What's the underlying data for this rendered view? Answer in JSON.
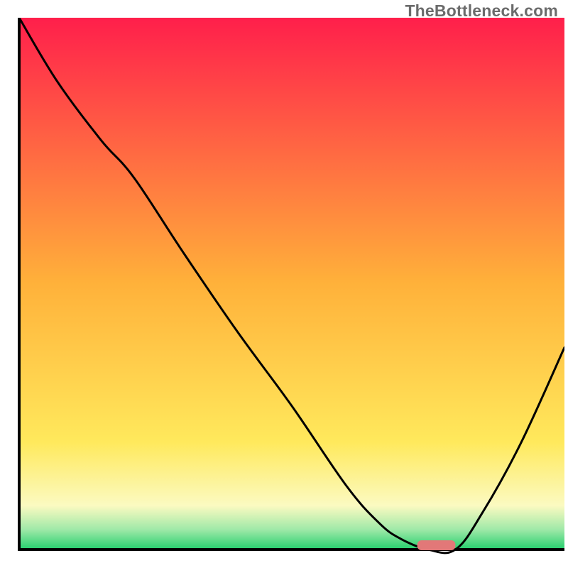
{
  "attribution": "TheBottleneck.com",
  "chart_data": {
    "type": "line",
    "title": "",
    "xlabel": "",
    "ylabel": "",
    "xlim": [
      0,
      100
    ],
    "ylim": [
      0,
      100
    ],
    "gradient_stops": [
      {
        "offset": 0.0,
        "color": "#ff1f4b"
      },
      {
        "offset": 0.5,
        "color": "#ffb13a"
      },
      {
        "offset": 0.8,
        "color": "#ffe95c"
      },
      {
        "offset": 0.92,
        "color": "#fbfac1"
      },
      {
        "offset": 0.965,
        "color": "#9fe9a8"
      },
      {
        "offset": 1.0,
        "color": "#2dd071"
      }
    ],
    "series": [
      {
        "name": "bottleneck-curve",
        "x": [
          0,
          7,
          15,
          21,
          30,
          40,
          50,
          60,
          66,
          70,
          75,
          80,
          85,
          92,
          100
        ],
        "y": [
          100,
          88,
          77,
          70,
          56,
          41,
          27,
          12,
          5,
          2,
          0,
          0,
          7,
          20,
          38
        ]
      }
    ],
    "marker": {
      "name": "optimal-range-marker",
      "x_start": 73,
      "x_end": 80,
      "y": 0.8,
      "color": "#e27878"
    },
    "axis_color": "#000000"
  }
}
